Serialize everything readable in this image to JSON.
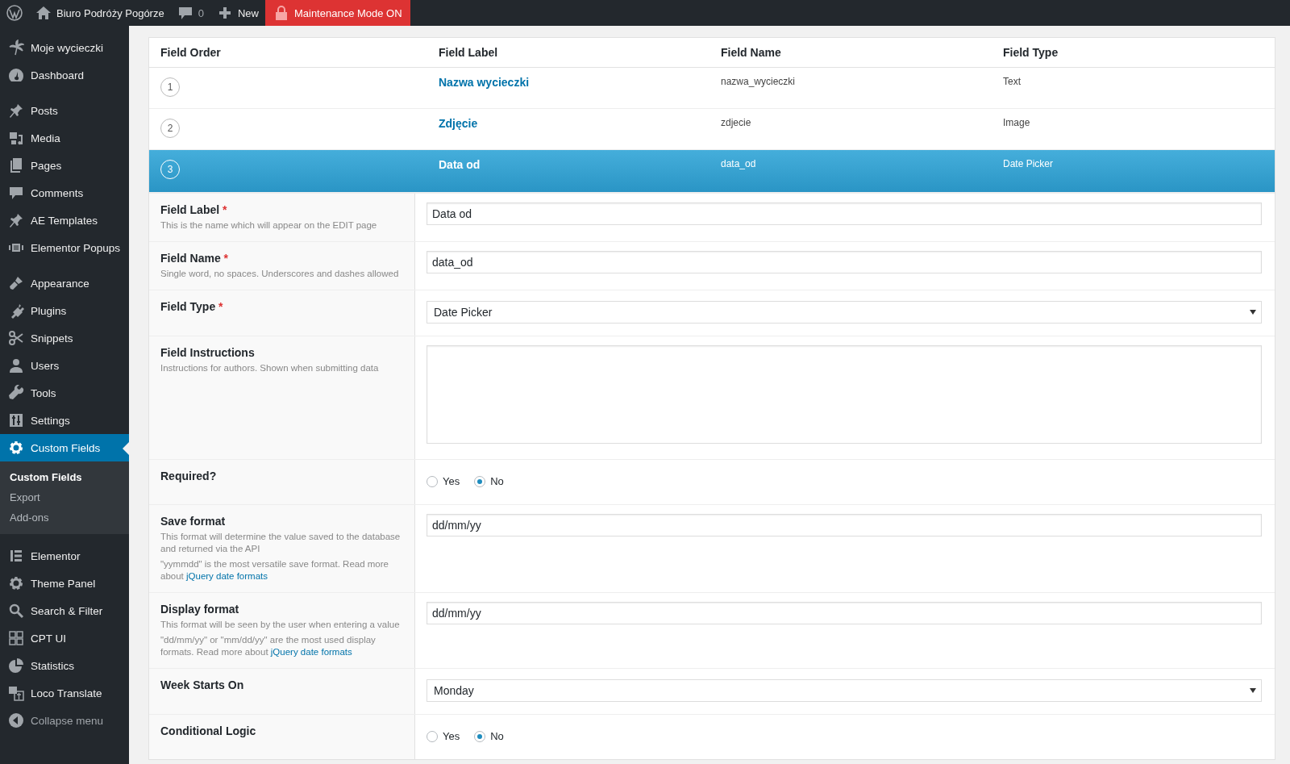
{
  "topbar": {
    "site_name": "Biuro Podróży Pogórze",
    "comments_count": "0",
    "new_label": "New",
    "maintenance_label": "Maintenance Mode ON"
  },
  "sidebar": {
    "groups": [
      [
        {
          "label": "Moje wycieczki",
          "selected": false
        },
        {
          "label": "Dashboard",
          "selected": false
        }
      ],
      [
        {
          "label": "Posts",
          "selected": false
        },
        {
          "label": "Media",
          "selected": false
        },
        {
          "label": "Pages",
          "selected": false
        },
        {
          "label": "Comments",
          "selected": false
        },
        {
          "label": "AE Templates",
          "selected": false
        },
        {
          "label": "Elementor Popups",
          "selected": false
        }
      ],
      [
        {
          "label": "Appearance",
          "selected": false
        },
        {
          "label": "Plugins",
          "selected": false
        },
        {
          "label": "Snippets",
          "selected": false
        },
        {
          "label": "Users",
          "selected": false
        },
        {
          "label": "Tools",
          "selected": false
        },
        {
          "label": "Settings",
          "selected": false
        },
        {
          "label": "Custom Fields",
          "selected": true,
          "children": [
            {
              "label": "Custom Fields",
              "selected": true
            },
            {
              "label": "Export",
              "selected": false
            },
            {
              "label": "Add-ons",
              "selected": false
            }
          ]
        }
      ],
      [
        {
          "label": "Elementor",
          "selected": false
        },
        {
          "label": "Theme Panel",
          "selected": false
        },
        {
          "label": "Search & Filter",
          "selected": false
        },
        {
          "label": "CPT UI",
          "selected": false
        },
        {
          "label": "Statistics",
          "selected": false
        },
        {
          "label": "Loco Translate",
          "selected": false
        },
        {
          "label": "Collapse menu",
          "selected": false
        }
      ]
    ]
  },
  "table": {
    "columns": [
      "Field Order",
      "Field Label",
      "Field Name",
      "Field Type"
    ],
    "rows": [
      {
        "order": "1",
        "label": "Nazwa wycieczki",
        "name": "nazwa_wycieczki",
        "type": "Text",
        "selected": false
      },
      {
        "order": "2",
        "label": "Zdjęcie",
        "name": "zdjecie",
        "type": "Image",
        "selected": false
      },
      {
        "order": "3",
        "label": "Data od",
        "name": "data_od",
        "type": "Date Picker",
        "selected": true
      }
    ]
  },
  "form": {
    "rows": [
      {
        "kind": "text",
        "label": "Field Label",
        "required_mark": "*",
        "instructions": [
          {
            "text": "This is the name which will appear on the EDIT page"
          }
        ],
        "value": "Data od"
      },
      {
        "kind": "text",
        "label": "Field Name",
        "required_mark": "*",
        "instructions": [
          {
            "text": "Single word, no spaces. Underscores and dashes allowed"
          }
        ],
        "value": "data_od"
      },
      {
        "kind": "select",
        "label": "Field Type",
        "required_mark": "*",
        "value": "Date Picker"
      },
      {
        "kind": "textarea",
        "label": "Field Instructions",
        "instructions": [
          {
            "text": "Instructions for authors. Shown when submitting data"
          }
        ]
      },
      {
        "kind": "radio",
        "label": "Required?",
        "options": [
          {
            "label": "Yes",
            "selected": false
          },
          {
            "label": "No",
            "selected": true
          }
        ]
      },
      {
        "kind": "text",
        "label": "Save format",
        "instructions": [
          {
            "text": "This format will determine the value saved to the database and returned via the API"
          },
          {
            "text": "\"yymmdd\" is the most versatile save format. Read more about ",
            "link": "jQuery date formats"
          }
        ],
        "value": "dd/mm/yy"
      },
      {
        "kind": "text",
        "label": "Display format",
        "instructions": [
          {
            "text": "This format will be seen by the user when entering a value"
          },
          {
            "text": "\"dd/mm/yy\" or \"mm/dd/yy\" are the most used display formats. Read more about ",
            "link": "jQuery date formats"
          }
        ],
        "value": "dd/mm/yy"
      },
      {
        "kind": "select",
        "label": "Week Starts On",
        "value": "Monday"
      },
      {
        "kind": "radio",
        "label": "Conditional Logic",
        "options": [
          {
            "label": "Yes",
            "selected": false
          },
          {
            "label": "No",
            "selected": true
          }
        ]
      }
    ]
  }
}
